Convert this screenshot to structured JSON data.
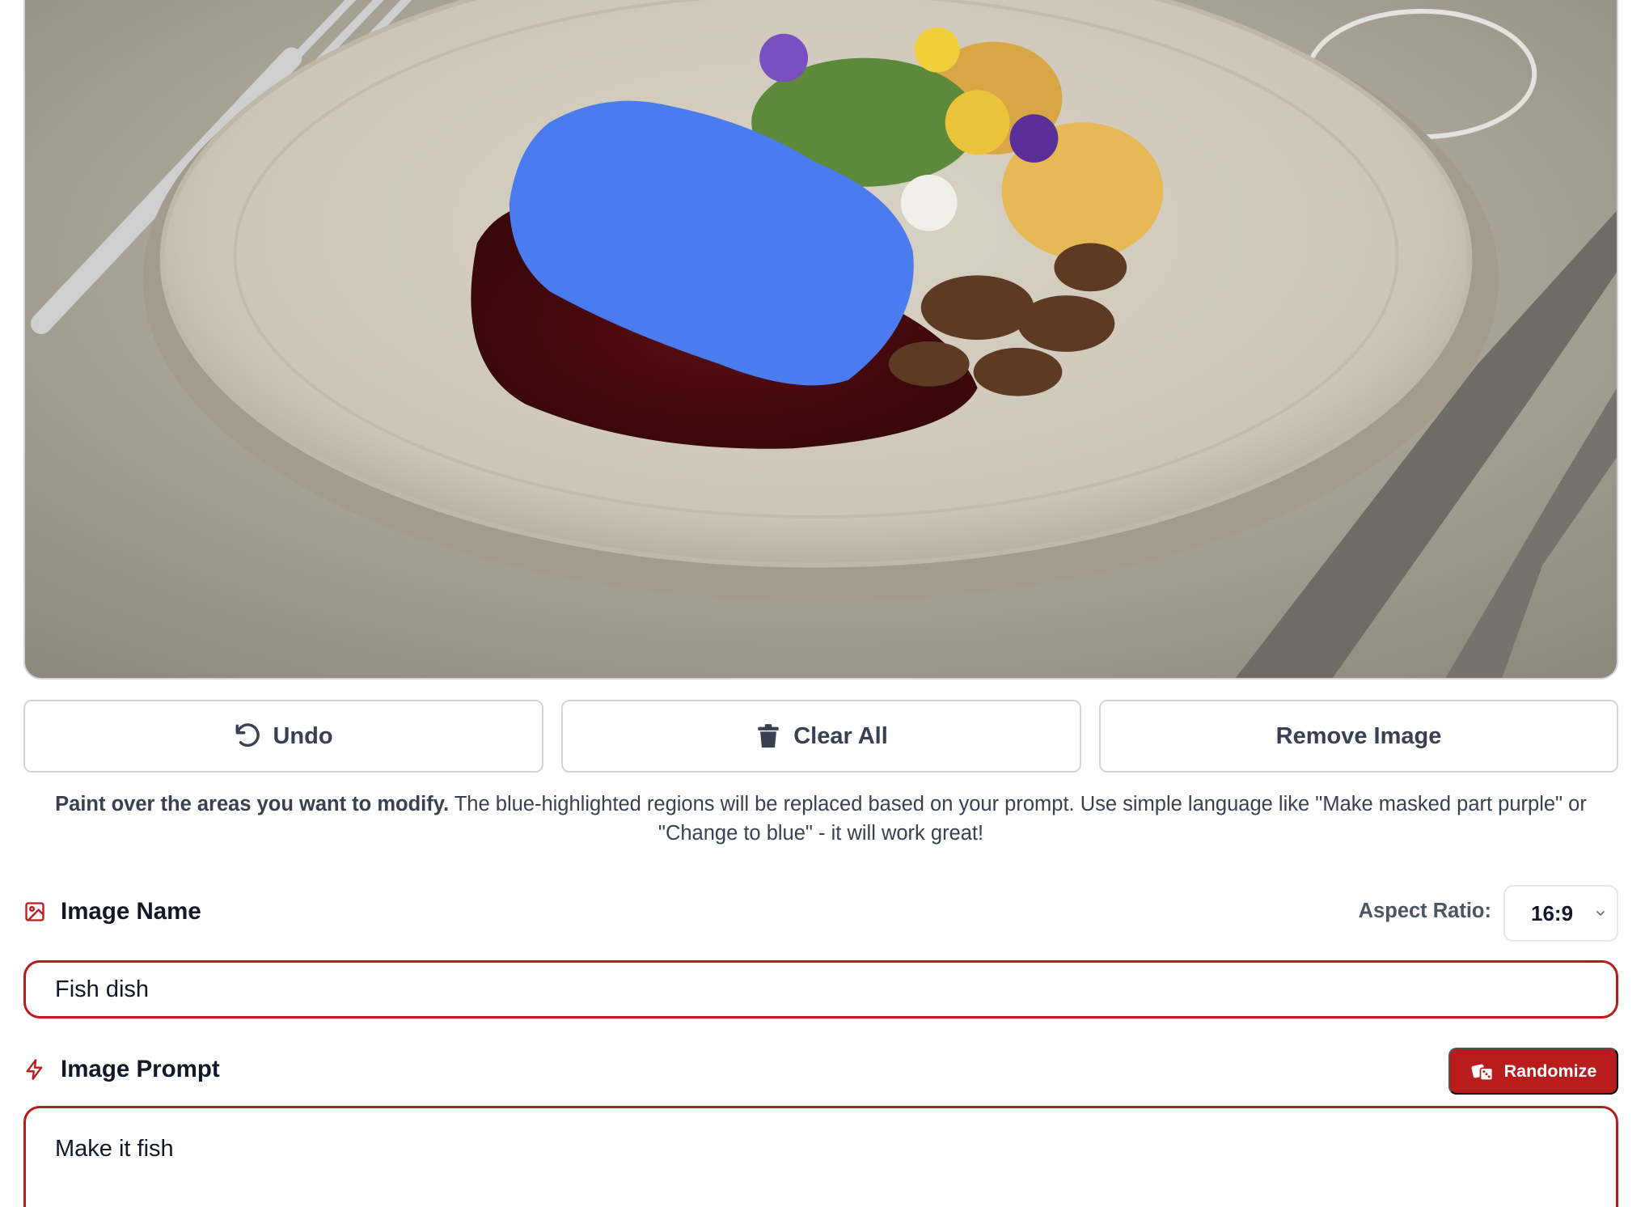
{
  "editor": {
    "image_alt": "Plated dish with dark sauce, mushrooms, roasted potatoes and edible flowers; masked region painted blue",
    "mask_color": "#4a7cf0"
  },
  "toolbar": {
    "undo_label": "Undo",
    "clear_label": "Clear All",
    "remove_label": "Remove Image"
  },
  "help": {
    "bold": "Paint over the areas you want to modify.",
    "text": " The blue-highlighted regions will be replaced based on your prompt. Use simple language like \"Make masked part purple\" or \"Change to blue\" - it will work great!"
  },
  "image_name": {
    "label": "Image Name",
    "icon": "image-icon",
    "value": "Fish dish"
  },
  "aspect_ratio": {
    "label": "Aspect Ratio:",
    "value": "16:9"
  },
  "image_prompt": {
    "label": "Image Prompt",
    "icon": "lightning-icon",
    "value": "Make it fish",
    "randomize_label": "Randomize"
  },
  "colors": {
    "accent": "#b91c1c",
    "mask": "#4a7cf0"
  }
}
